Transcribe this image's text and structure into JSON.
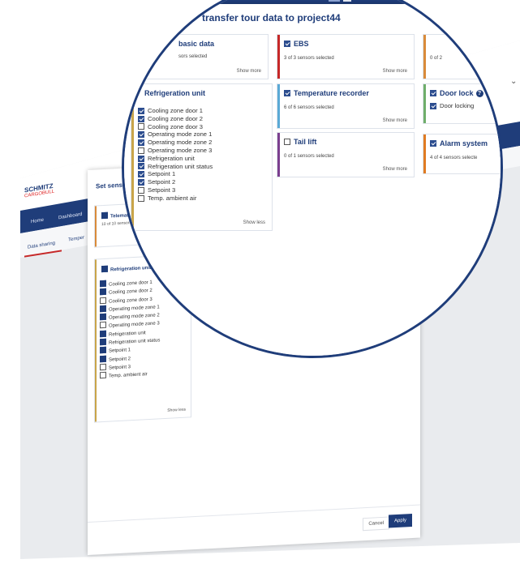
{
  "app": {
    "logo_line1": "SCHMITZ",
    "logo_line2": "CARGOBULL",
    "nav": [
      "Home",
      "Dashboard"
    ],
    "tabs": [
      "Data sharing",
      "Temper"
    ]
  },
  "dialog": {
    "title_bg": "Set sensor",
    "title_lens": "transfer tour data to project44",
    "cancel_label": "Cancel",
    "apply_label": "Apply",
    "telematics_header": "Telematics",
    "telematics_sub": "10 of 10 sensors",
    "show_less_label": "Show less",
    "show_more_label": "Show more"
  },
  "cards": {
    "basic": {
      "title": "basic data",
      "sub": "sors selected",
      "more": "Show more"
    },
    "ebs": {
      "title": "EBS",
      "sub": "3 of 3 sensors selected",
      "more": "Show more"
    },
    "third": {
      "sub": "0 of 2"
    },
    "refrigeration": {
      "title": "Refrigeration unit",
      "items": [
        {
          "label": "Cooling zone door 1",
          "checked": true
        },
        {
          "label": "Cooling zone door 2",
          "checked": true
        },
        {
          "label": "Cooling zone door 3",
          "checked": false
        },
        {
          "label": "Operating mode zone 1",
          "checked": true
        },
        {
          "label": "Operating mode zone 2",
          "checked": true
        },
        {
          "label": "Operating mode zone 3",
          "checked": false
        },
        {
          "label": "Refrigeration unit",
          "checked": true
        },
        {
          "label": "Refrigeration unit status",
          "checked": true
        },
        {
          "label": "Setpoint 1",
          "checked": true
        },
        {
          "label": "Setpoint 2",
          "checked": true
        },
        {
          "label": "Setpoint 3",
          "checked": false
        },
        {
          "label": "Temp. ambient air",
          "checked": false
        }
      ],
      "less": "Show less"
    },
    "temperature": {
      "title": "Temperature recorder",
      "sub": "6 of 6 sensors selected",
      "more": "Show more"
    },
    "taillift": {
      "title": "Tail lift",
      "sub": "0 of 1 sensors selected",
      "more": "Show more"
    },
    "doorlock": {
      "title": "Door lock",
      "item": "Door locking"
    },
    "alarm": {
      "title": "Alarm system",
      "sub": "4 of 4 sensors selecte"
    }
  },
  "colors": {
    "brand_blue": "#1f3d7a",
    "ebs_bar": "#c62828",
    "refrigeration_bar": "#c9a54a",
    "temperature_bar": "#5aa9d6",
    "taillift_bar": "#7b3f8f",
    "doorlock_bar": "#6fae6a",
    "alarm_bar": "#e07b22",
    "third_bar": "#d98b3a"
  }
}
